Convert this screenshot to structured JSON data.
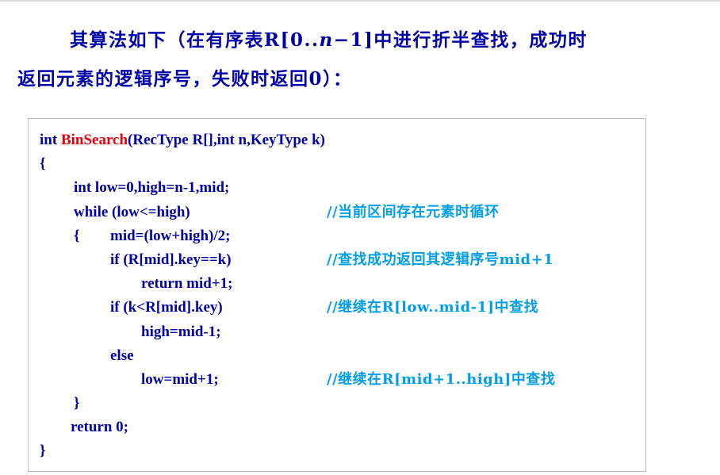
{
  "intro": {
    "line1_a": "其算法如下（在有序表R[0..",
    "line1_n": "n",
    "line1_b": "−1]中进行折半查找，成功时",
    "line2": "返回元素的逻辑序号，失败时返回0）："
  },
  "code": {
    "sig_type": "int ",
    "sig_name": "BinSearch",
    "sig_params": "(RecType R[],int n,KeyType k)",
    "l2": "{",
    "l3": "int low=0,high=n-1,mid;",
    "l4": "while (low<=high)",
    "l4_comment": "//当前区间存在元素时循环",
    "l5_brace": "{",
    "l5": "mid=(low+high)/2;",
    "l6": "if (R[mid].key==k)",
    "l6_comment": "//查找成功返回其逻辑序号mid+1",
    "l7": "return mid+1;",
    "l8": "if (k<R[mid].key)",
    "l8_comment": "//继续在R[low..mid-1]中查找",
    "l9": "high=mid-1;",
    "l10": "else",
    "l11": "low=mid+1;",
    "l11_comment": "//继续在R[mid+1..high]中查找",
    "l12": "}",
    "l13": "return 0;",
    "l14": "}"
  },
  "colors": {
    "text": "#0000a8",
    "function_name": "#e8000b",
    "comment": "#009ee8"
  }
}
